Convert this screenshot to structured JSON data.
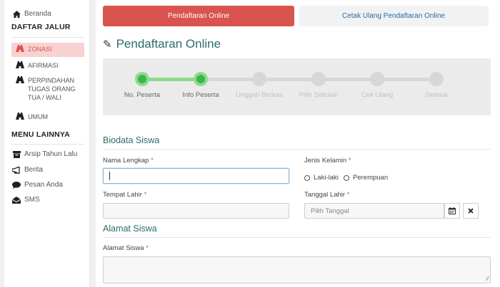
{
  "sidebar": {
    "home_label": "Beranda",
    "jalur_heading": "DAFTAR JALUR",
    "jalur_items": [
      {
        "label": "ZONASI",
        "icon": "road-icon",
        "active": true
      },
      {
        "label": "AFIRMASI",
        "icon": "road-icon",
        "active": false
      },
      {
        "label": "PERPINDAHAN TUGAS ORANG TUA / WALI",
        "icon": "road-icon",
        "active": false
      },
      {
        "label": "UMUM",
        "icon": "road-icon",
        "active": false
      }
    ],
    "menu_heading": "MENU LAINNYA",
    "menu_items": [
      {
        "label": "Arsip Tahun Lalu",
        "icon": "archive-icon"
      },
      {
        "label": "Berita",
        "icon": "bullhorn-icon"
      },
      {
        "label": "Pesan Anda",
        "icon": "comment-icon"
      },
      {
        "label": "SMS",
        "icon": "envelope-icon"
      }
    ]
  },
  "tabs": {
    "online": "Pendaftaran Online",
    "reprint": "Cetak Ulang Pendaftaran Online"
  },
  "page_title": "Pendaftaran Online",
  "steps": [
    {
      "label": "No. Peserta",
      "done": true
    },
    {
      "label": "Info Peserta",
      "done": true
    },
    {
      "label": "Unggah Berkas",
      "done": false
    },
    {
      "label": "Pilih Sekolah",
      "done": false
    },
    {
      "label": "Cek Ulang",
      "done": false
    },
    {
      "label": "Selesai",
      "done": false
    }
  ],
  "biodata": {
    "title": "Biodata Siswa",
    "nama_label": "Nama Lengkap",
    "nama_value": "",
    "jk_label": "Jenis Kelamin",
    "jk_options": [
      "Laki-laki",
      "Perempuan"
    ],
    "tempat_label": "Tempat Lahir",
    "tempat_value": "",
    "tanggal_label": "Tanggal Lahir",
    "tanggal_placeholder": "Pilih Tanggal"
  },
  "alamat": {
    "title": "Alamat Siswa",
    "label": "Alamat Siswa",
    "value": ""
  },
  "required_mark": "*",
  "colors": {
    "accent_red": "#d9534f",
    "title_teal": "#2a6e6a",
    "step_green": "#3cb54a",
    "step_green_light": "#8ddb8d",
    "link_blue": "#2b6ca3"
  }
}
